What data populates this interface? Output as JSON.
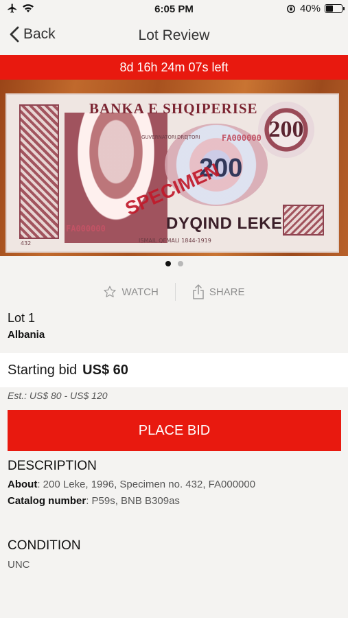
{
  "status": {
    "time": "6:05 PM",
    "battery": "40%",
    "battery_fraction": 0.4,
    "left_icons": [
      "airplane-icon",
      "wifi-icon"
    ],
    "right_icons": [
      "orientation-lock-icon",
      "battery-icon"
    ]
  },
  "nav": {
    "back_label": "Back",
    "title": "Lot Review"
  },
  "timer": {
    "text": "8d 16h 24m 07s left"
  },
  "carousel": {
    "image_alt": "banknote",
    "page_count": 2,
    "current_page": 1,
    "banknote_text": {
      "top": "BANKA E SHQIPERISE",
      "value": "200",
      "specimen": "SPECIMEN",
      "words": "DYQIND LEKE",
      "serial": "FA000000",
      "specimen_no": "432",
      "portrait_caption": "ISMAIL QEMALI 1844-1919",
      "sign_left": "GUVERNATORI",
      "sign_right": "DREJTORI"
    }
  },
  "actions": {
    "watch_label": "WATCH",
    "share_label": "SHARE"
  },
  "lot": {
    "title": "Lot 1",
    "country": "Albania",
    "starting_bid_label": "Starting bid",
    "starting_bid_value": "US$ 60",
    "estimate": "Est.: US$ 80 - US$ 120",
    "place_bid_label": "PLACE BID"
  },
  "description": {
    "heading": "DESCRIPTION",
    "about_label": "About",
    "about_value": ": 200 Leke, 1996, Specimen no. 432, FA000000",
    "catalog_label": "Catalog number",
    "catalog_value": ": P59s, BNB B309as"
  },
  "condition": {
    "heading": "CONDITION",
    "value": "UNC"
  },
  "colors": {
    "accent": "#e8190f",
    "background": "#f4f3f1",
    "muted_text": "#8f8f8f"
  }
}
